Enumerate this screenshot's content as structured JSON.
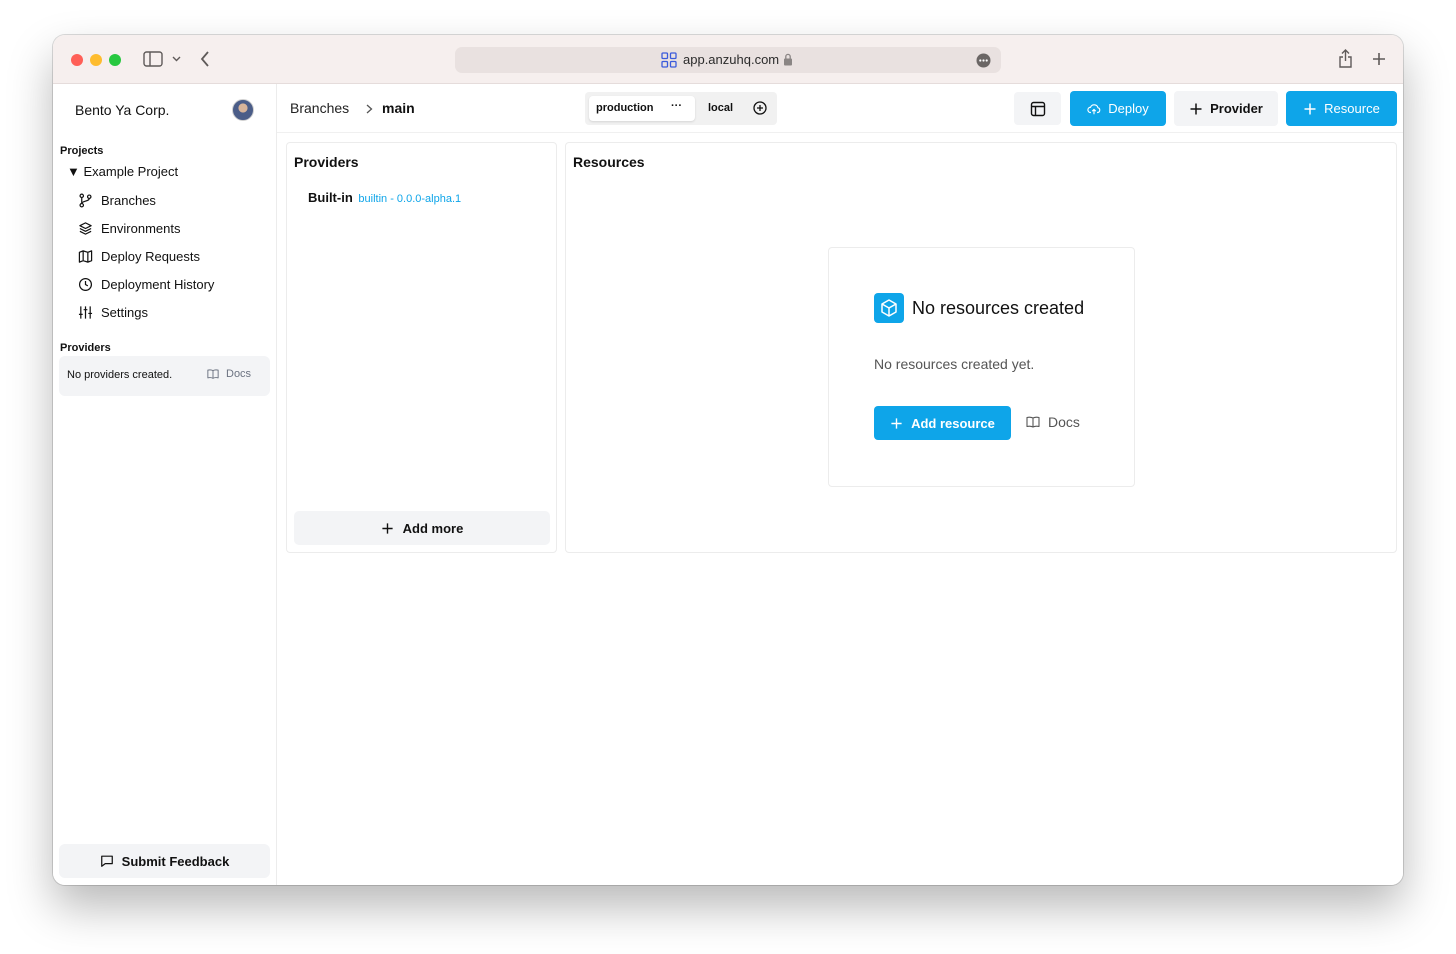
{
  "browser": {
    "url": "app.anzuhq.com",
    "traffic_lights": [
      "#ff5f57",
      "#febc2e",
      "#28c840"
    ]
  },
  "sidebar": {
    "org_name": "Bento Ya Corp.",
    "projects_label": "Projects",
    "project_name": "▼ Example Project",
    "nav": [
      {
        "label": "Branches",
        "icon": "git-branch-icon"
      },
      {
        "label": "Environments",
        "icon": "layers-icon"
      },
      {
        "label": "Deploy Requests",
        "icon": "map-icon"
      },
      {
        "label": "Deployment History",
        "icon": "clock-icon"
      },
      {
        "label": "Settings",
        "icon": "sliders-icon"
      }
    ],
    "providers_label": "Providers",
    "no_providers": "No providers created.",
    "docs_label": "Docs",
    "feedback_label": "Submit Feedback"
  },
  "header": {
    "breadcrumb_root": "Branches",
    "breadcrumb_sep": ">",
    "breadcrumb_current": "main",
    "env_active": "production",
    "env_active_menu": "···",
    "env_other": "local",
    "deploy_label": "Deploy",
    "provider_label": "Provider",
    "resource_label": "Resource"
  },
  "providers_panel": {
    "title": "Providers",
    "item_name": "Built-in",
    "item_tag": "builtin - 0.0.0-alpha.1",
    "add_more_label": "Add more"
  },
  "resources_panel": {
    "title": "Resources",
    "empty_title": "No resources created",
    "empty_desc": "No resources created yet.",
    "add_label": "Add resource",
    "docs_label": "Docs"
  },
  "colors": {
    "accent": "#0ea5e9",
    "titlebar": "#f6efee",
    "muted_bg": "#f3f4f6"
  }
}
